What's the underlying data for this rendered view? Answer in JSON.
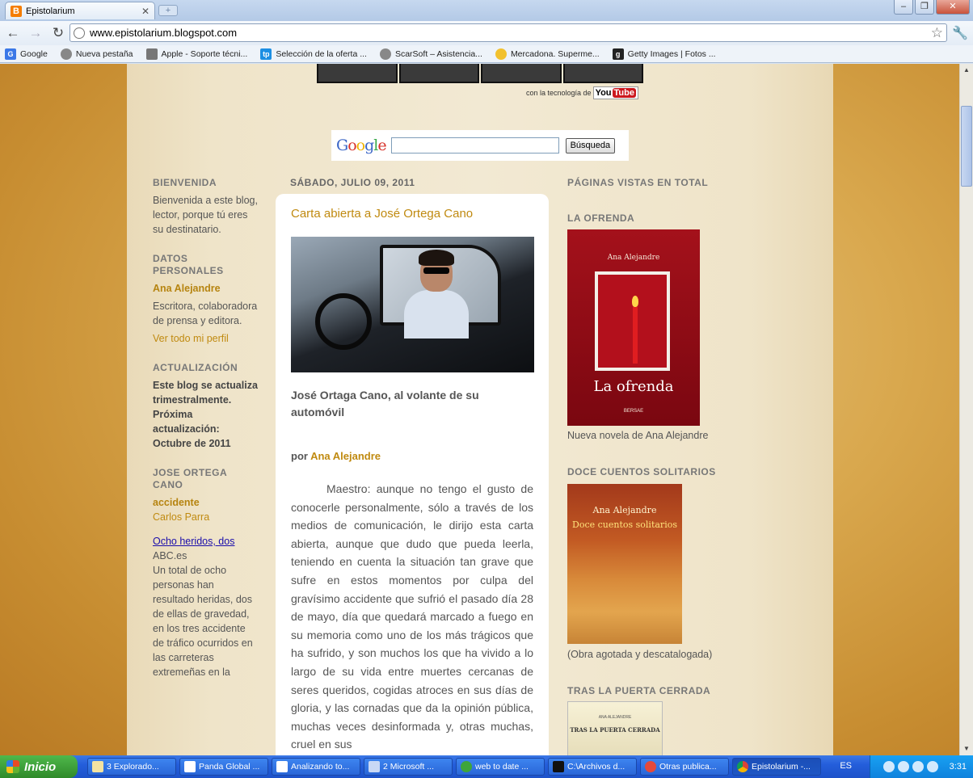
{
  "browser": {
    "tab_title": "Epistolarium",
    "url": "www.epistolarium.blogspot.com",
    "bookmarks": [
      {
        "label": "Google",
        "icon": "google-icon",
        "color": "#3b78e7"
      },
      {
        "label": "Nueva pestaña",
        "icon": "globe-icon",
        "color": "#888888"
      },
      {
        "label": "Apple - Soporte técni...",
        "icon": "apple-icon",
        "color": "#777777"
      },
      {
        "label": "Selección de la oferta ...",
        "icon": "tp-icon",
        "color": "#1d8fe3"
      },
      {
        "label": "ScarSoft – Asistencia...",
        "icon": "globe-icon",
        "color": "#888888"
      },
      {
        "label": "Mercadona. Superme...",
        "icon": "sun-icon",
        "color": "#f2c12e"
      },
      {
        "label": "Getty Images | Fotos ...",
        "icon": "getty-icon",
        "color": "#222222"
      }
    ]
  },
  "page": {
    "youtube_credit": "con la tecnología de",
    "youtube_you": "You",
    "youtube_tube": "Tube",
    "google_logo": "Google",
    "search_button": "Búsqueda",
    "left_sidebar": {
      "welcome_title": "BIENVENIDA",
      "welcome_text": "Bienvenida a este blog, lector, porque tú eres su destinatario.",
      "profile_title": "DATOS PERSONALES",
      "profile_name": "Ana Alejandre",
      "profile_desc": "Escritora, colaboradora de prensa y editora.",
      "profile_link": "Ver todo mi perfil",
      "update_title": "ACTUALIZACIÓN",
      "update_text": "Este blog se actualiza trimestralmente. Próxima actualización: Octubre de 2011",
      "news_title": "JOSE ORTEGA CANO",
      "news_tag1": "accidente",
      "news_tag2": "Carlos Parra",
      "news_link": "Ocho heridos, dos",
      "news_source": "ABC.es",
      "news_text": "Un total de ocho personas han resultado heridas, dos de ellas de gravedad, en los tres accidente de tráfico ocurridos en las carreteras extremeñas en la"
    },
    "post": {
      "date": "SÁBADO, JULIO 09, 2011",
      "title": "Carta abierta a José Ortega Cano",
      "caption": "José Ortaga Cano, al volante de su automóvil",
      "by_prefix": "por",
      "author": "Ana Alejandre",
      "body": "Maestro: aunque no tengo el gusto de conocerle personalmente, sólo a través de los medios de comunicación, le dirijo esta carta abierta, aunque que dudo que pueda leerla, teniendo en cuenta la situación tan grave que sufre en estos momentos por culpa del gravísimo accidente que sufrió el pasado día 28 de mayo, día que quedará marcado a fuego en su memoria como uno de los más trágicos que ha sufrido, y son muchos los que ha vivido a lo largo de su vida  entre muertes cercanas de seres queridos, cogidas atroces en sus días de gloria, y las cornadas que da la opinión pública, muchas veces desinformada y, otras muchas, cruel en sus"
    },
    "right_sidebar": {
      "views_title": "PÁGINAS VISTAS EN TOTAL",
      "ofrenda_title": "LA OFRENDA",
      "ofrenda_author": "Ana Alejandre",
      "ofrenda_book": "La ofrenda",
      "ofrenda_pub": "BERSAE",
      "ofrenda_caption": "Nueva novela de Ana Alejandre",
      "doce_title": "DOCE CUENTOS SOLITARIOS",
      "doce_author": "Ana Alejandre",
      "doce_book": "Doce cuentos solitarios",
      "doce_caption": "(Obra agotada y descatalogada)",
      "puerta_title": "TRAS LA PUERTA CERRADA",
      "puerta_author": "ANA ALEJANDRE",
      "puerta_book": "TRAS LA PUERTA CERRADA"
    }
  },
  "taskbar": {
    "start_label": "Inicio",
    "tasks": [
      {
        "label": "3 Explorado...",
        "active": false
      },
      {
        "label": "Panda Global ...",
        "active": false
      },
      {
        "label": "Analizando to...",
        "active": false
      },
      {
        "label": "2 Microsoft ...",
        "active": false
      },
      {
        "label": "web to date ...",
        "active": false
      },
      {
        "label": "C:\\Archivos d...",
        "active": false
      },
      {
        "label": "Otras publica...",
        "active": false
      },
      {
        "label": "Epistolarium -...",
        "active": true
      }
    ],
    "language": "ES",
    "clock": "3:31"
  }
}
